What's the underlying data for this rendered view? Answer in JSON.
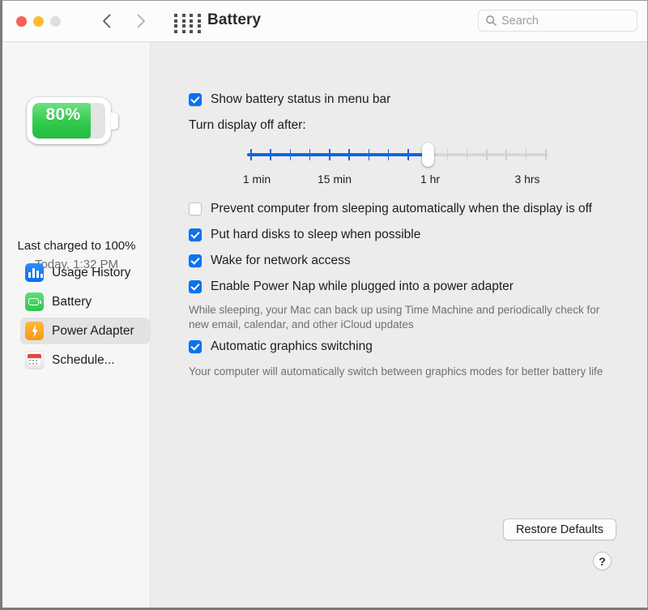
{
  "window": {
    "title": "Battery",
    "traffic_lights": [
      "close",
      "minimize",
      "zoom"
    ],
    "back_icon": "chevron-left-icon",
    "forward_icon": "chevron-right-icon",
    "grid_icon": "show-all-grid-icon"
  },
  "search": {
    "placeholder": "Search",
    "value": "",
    "icon": "search-icon"
  },
  "sidebar": {
    "battery": {
      "percent_label": "80%",
      "percent_value": 80,
      "fill_color": "#33cc4e"
    },
    "last_charged": "Last charged to 100%",
    "last_charged_time": "Today, 1:32 PM",
    "items": [
      {
        "label": "Usage History",
        "icon": "usage-history-icon",
        "selected": false
      },
      {
        "label": "Battery",
        "icon": "battery-icon",
        "selected": false
      },
      {
        "label": "Power Adapter",
        "icon": "power-adapter-icon",
        "selected": true
      },
      {
        "label": "Schedule...",
        "icon": "schedule-calendar-icon",
        "selected": false
      }
    ]
  },
  "main": {
    "menu_bar_checkbox": {
      "label": "Show battery status in menu bar",
      "checked": true
    },
    "display_off_label": "Turn display off after:",
    "slider": {
      "value_label": "1 hr",
      "fill_percent": 60,
      "tick_count": 16,
      "ticks_filled": 10,
      "labels": [
        "1 min",
        "15 min",
        "1 hr",
        "3 hrs"
      ],
      "accent_color": "#1066e0"
    },
    "options": [
      {
        "label": "Prevent computer from sleeping automatically when the display is off",
        "checked": false
      },
      {
        "label": "Put hard disks to sleep when possible",
        "checked": true
      },
      {
        "label": "Wake for network access",
        "checked": true
      },
      {
        "label": "Enable Power Nap while plugged into a power adapter",
        "checked": true
      }
    ],
    "power_nap_help": "While sleeping, your Mac can back up using Time Machine and periodically check for new email, calendar, and other iCloud updates",
    "graphics_checkbox": {
      "label": "Automatic graphics switching",
      "checked": true
    },
    "graphics_help": "Your computer will automatically switch between graphics modes for better battery life",
    "restore_defaults_label": "Restore Defaults",
    "help_button_label": "?"
  }
}
